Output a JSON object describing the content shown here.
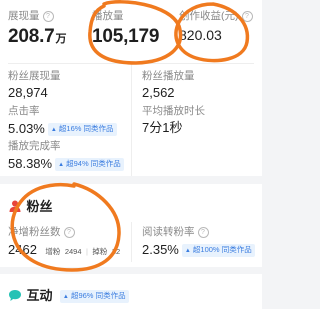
{
  "overview": {
    "exposure": {
      "label": "展现量",
      "value": "208.7",
      "unit": "万"
    },
    "plays": {
      "label": "播放量",
      "value": "105,179"
    },
    "income": {
      "label": "创作收益(元)",
      "value": "820.03"
    },
    "fan_exposure": {
      "label": "粉丝展现量",
      "value": "28,974"
    },
    "fan_plays": {
      "label": "粉丝播放量",
      "value": "2,562"
    },
    "ctr": {
      "label": "点击率",
      "value": "5.03%",
      "badge": "超16% 同类作品"
    },
    "avg_duration": {
      "label": "平均播放时长",
      "value": "7分1秒"
    },
    "completion": {
      "label": "播放完成率",
      "value": "58.38%",
      "badge": "超94% 同类作品"
    }
  },
  "fans": {
    "title": "粉丝",
    "net_growth": {
      "label": "净增粉丝数",
      "value": "2462",
      "gain_label": "增粉",
      "gain_value": "2494",
      "loss_label": "掉粉",
      "loss_value": "32"
    },
    "conversion": {
      "label": "阅读转粉率",
      "value": "2.35%",
      "badge": "超100% 同类作品"
    }
  },
  "interaction": {
    "title": "互动",
    "badge": "超96% 同类作品"
  },
  "colors": {
    "accent_orange": "#f07a1f",
    "badge_blue": "#3b7de0",
    "fan_red": "#e8453c",
    "interaction_teal": "#26c2b5"
  }
}
